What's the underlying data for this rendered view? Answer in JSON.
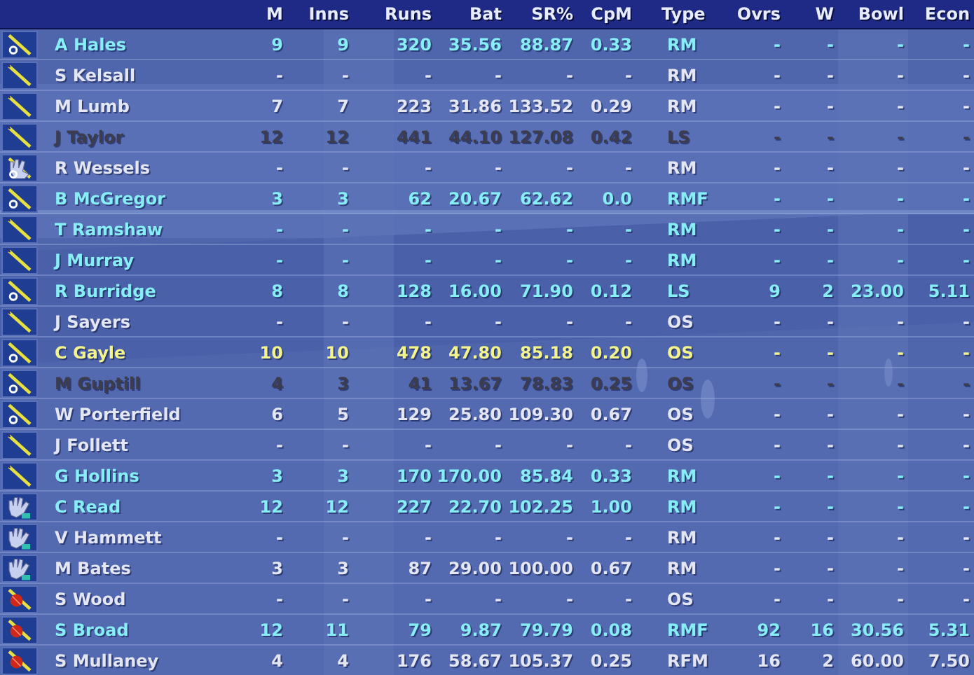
{
  "table": {
    "columns": [
      "M",
      "Inns",
      "Runs",
      "Bat",
      "SR%",
      "CpM",
      "Type",
      "Ovrs",
      "W",
      "Bowl",
      "Econ"
    ],
    "rows": [
      {
        "kind": "bat-ring",
        "color": "#88eef6",
        "name": "A Hales",
        "cells": [
          "9",
          "9",
          "320",
          "35.56",
          "88.87",
          "0.33",
          "RM",
          "-",
          "-",
          "-",
          "-"
        ]
      },
      {
        "kind": "bat",
        "color": "#e4e6f2",
        "name": "S Kelsall",
        "cells": [
          "-",
          "-",
          "-",
          "-",
          "-",
          "-",
          "RM",
          "-",
          "-",
          "-",
          "-"
        ]
      },
      {
        "kind": "bat",
        "color": "#e4e6f2",
        "name": "M Lumb",
        "cells": [
          "7",
          "7",
          "223",
          "31.86",
          "133.52",
          "0.29",
          "RM",
          "-",
          "-",
          "-",
          "-"
        ]
      },
      {
        "kind": "bat",
        "color": "#3c3c4c",
        "name": "J Taylor",
        "cells": [
          "12",
          "12",
          "441",
          "44.10",
          "127.08",
          "0.42",
          "LS",
          "-",
          "-",
          "-",
          "-"
        ]
      },
      {
        "kind": "glove-bat",
        "color": "#e4e6f2",
        "name": "R Wessels",
        "cells": [
          "-",
          "-",
          "-",
          "-",
          "-",
          "-",
          "RM",
          "-",
          "-",
          "-",
          "-"
        ]
      },
      {
        "kind": "bat-ring",
        "color": "#88eef6",
        "name": "B McGregor",
        "cells": [
          "3",
          "3",
          "62",
          "20.67",
          "62.62",
          "0.0",
          "RMF",
          "-",
          "-",
          "-",
          "-"
        ]
      },
      {
        "kind": "bat",
        "color": "#88eef6",
        "name": "T Ramshaw",
        "cells": [
          "-",
          "-",
          "-",
          "-",
          "-",
          "-",
          "RM",
          "-",
          "-",
          "-",
          "-"
        ]
      },
      {
        "kind": "bat",
        "color": "#88eef6",
        "name": "J Murray",
        "cells": [
          "-",
          "-",
          "-",
          "-",
          "-",
          "-",
          "RM",
          "-",
          "-",
          "-",
          "-"
        ]
      },
      {
        "kind": "bat-ring",
        "color": "#88eef6",
        "name": "R Burridge",
        "cells": [
          "8",
          "8",
          "128",
          "16.00",
          "71.90",
          "0.12",
          "LS",
          "9",
          "2",
          "23.00",
          "5.11"
        ]
      },
      {
        "kind": "bat",
        "color": "#e4e6f2",
        "name": "J Sayers",
        "cells": [
          "-",
          "-",
          "-",
          "-",
          "-",
          "-",
          "OS",
          "-",
          "-",
          "-",
          "-"
        ]
      },
      {
        "kind": "bat-ring",
        "color": "#f4f48c",
        "name": "C Gayle",
        "cells": [
          "10",
          "10",
          "478",
          "47.80",
          "85.18",
          "0.20",
          "OS",
          "-",
          "-",
          "-",
          "-"
        ]
      },
      {
        "kind": "bat-ring",
        "color": "#3c3c4c",
        "name": "M Guptill",
        "cells": [
          "4",
          "3",
          "41",
          "13.67",
          "78.83",
          "0.25",
          "OS",
          "-",
          "-",
          "-",
          "-"
        ]
      },
      {
        "kind": "bat-ring",
        "color": "#e4e6f2",
        "name": "W Porterfield",
        "cells": [
          "6",
          "5",
          "129",
          "25.80",
          "109.30",
          "0.67",
          "OS",
          "-",
          "-",
          "-",
          "-"
        ]
      },
      {
        "kind": "bat",
        "color": "#e4e6f2",
        "name": "J Follett",
        "cells": [
          "-",
          "-",
          "-",
          "-",
          "-",
          "-",
          "OS",
          "-",
          "-",
          "-",
          "-"
        ]
      },
      {
        "kind": "bat",
        "color": "#88eef6",
        "name": "G Hollins",
        "cells": [
          "3",
          "3",
          "170",
          "170.00",
          "85.84",
          "0.33",
          "RM",
          "-",
          "-",
          "-",
          "-"
        ]
      },
      {
        "kind": "glove",
        "color": "#88eef6",
        "name": "C Read",
        "cells": [
          "12",
          "12",
          "227",
          "22.70",
          "102.25",
          "1.00",
          "RM",
          "-",
          "-",
          "-",
          "-"
        ]
      },
      {
        "kind": "glove",
        "color": "#e4e6f2",
        "name": "V Hammett",
        "cells": [
          "-",
          "-",
          "-",
          "-",
          "-",
          "-",
          "RM",
          "-",
          "-",
          "-",
          "-"
        ]
      },
      {
        "kind": "glove",
        "color": "#e4e6f2",
        "name": "M Bates",
        "cells": [
          "3",
          "3",
          "87",
          "29.00",
          "100.00",
          "0.67",
          "RM",
          "-",
          "-",
          "-",
          "-"
        ]
      },
      {
        "kind": "ball-bat",
        "color": "#e4e6f2",
        "name": "S Wood",
        "cells": [
          "-",
          "-",
          "-",
          "-",
          "-",
          "-",
          "OS",
          "-",
          "-",
          "-",
          "-"
        ]
      },
      {
        "kind": "ball-bat",
        "color": "#88eef6",
        "name": "S Broad",
        "cells": [
          "12",
          "11",
          "79",
          "9.87",
          "79.79",
          "0.08",
          "RMF",
          "92",
          "16",
          "30.56",
          "5.31"
        ]
      },
      {
        "kind": "ball-bat",
        "color": "#e4e6f2",
        "name": "S Mullaney",
        "cells": [
          "4",
          "4",
          "176",
          "58.67",
          "105.37",
          "0.25",
          "RFM",
          "16",
          "2",
          "60.00",
          "7.50"
        ]
      }
    ]
  }
}
